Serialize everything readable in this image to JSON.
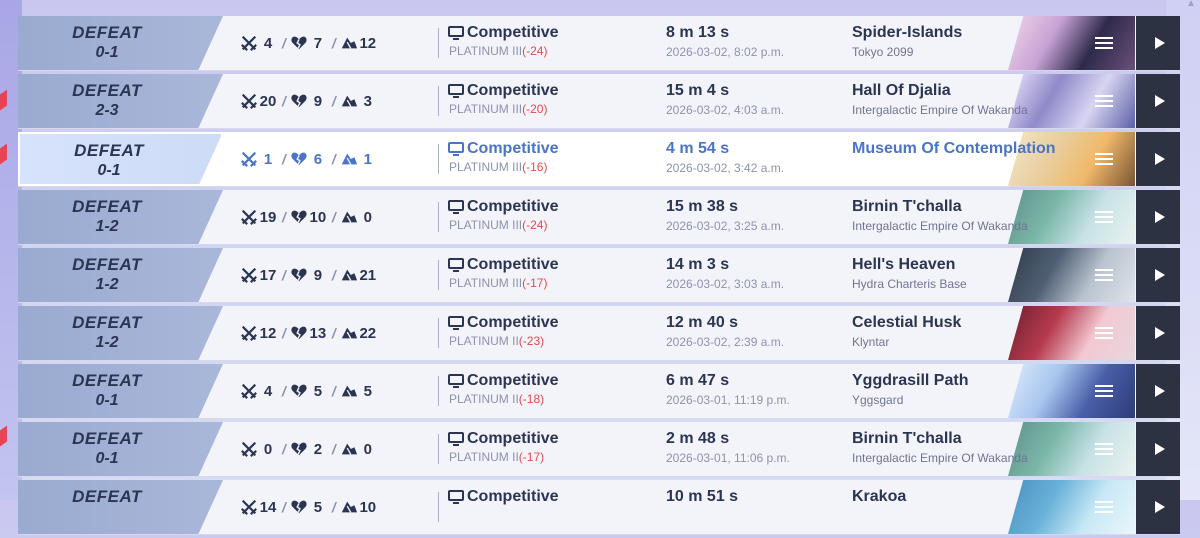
{
  "matches": [
    {
      "result": "DEFEAT",
      "score": "0-1",
      "kills": "4",
      "deaths": "7",
      "assists": "12",
      "mode": "Competitive",
      "rank": "PLATINUM III",
      "delta": "(-24)",
      "duration": "8 m 13 s",
      "date": "2026-03-02, 8:02 p.m.",
      "map": "Spider-Islands",
      "region": "Tokyo 2099",
      "thumb": [
        "#2e2a4a",
        "#c7a2d6",
        "#6b4f7a",
        "#f1d7e6"
      ]
    },
    {
      "result": "DEFEAT",
      "score": "2-3",
      "kills": "20",
      "deaths": "9",
      "assists": "3",
      "mode": "Competitive",
      "rank": "PLATINUM III",
      "delta": "(-20)",
      "duration": "15 m 4 s",
      "date": "2026-03-02, 4:03 a.m.",
      "map": "Hall Of Djalia",
      "region": "Intergalactic Empire Of Wakanda",
      "thumb": [
        "#d8d5f2",
        "#8f8ac9",
        "#5b5fa6",
        "#efe6ff"
      ]
    },
    {
      "result": "DEFEAT",
      "score": "0-1",
      "kills": "1",
      "deaths": "6",
      "assists": "1",
      "mode": "Competitive",
      "rank": "PLATINUM III",
      "delta": "(-16)",
      "duration": "4 m 54 s",
      "date": "2026-03-02, 3:42 a.m.",
      "map": "Museum Of Contemplation",
      "region": "",
      "thumb": [
        "#f0b96a",
        "#e8cfa0",
        "#7a5434",
        "#f6e6c9"
      ]
    },
    {
      "result": "DEFEAT",
      "score": "1-2",
      "kills": "19",
      "deaths": "10",
      "assists": "0",
      "mode": "Competitive",
      "rank": "PLATINUM III",
      "delta": "(-24)",
      "duration": "15 m 38 s",
      "date": "2026-03-02, 3:25 a.m.",
      "map": "Birnin T'challa",
      "region": "Intergalactic Empire Of Wakanda",
      "thumb": [
        "#c9e2e6",
        "#7bb7a9",
        "#e9f3f0",
        "#5e8f8a"
      ]
    },
    {
      "result": "DEFEAT",
      "score": "1-2",
      "kills": "17",
      "deaths": "9",
      "assists": "21",
      "mode": "Competitive",
      "rank": "PLATINUM III",
      "delta": "(-17)",
      "duration": "14 m 3 s",
      "date": "2026-03-02, 3:03 a.m.",
      "map": "Hell's Heaven",
      "region": "Hydra Charteris Base",
      "thumb": [
        "#b9c3cf",
        "#4f5f73",
        "#dfe4ea",
        "#2f3a49"
      ]
    },
    {
      "result": "DEFEAT",
      "score": "1-2",
      "kills": "12",
      "deaths": "13",
      "assists": "22",
      "mode": "Competitive",
      "rank": "PLATINUM II",
      "delta": "(-23)",
      "duration": "12 m 40 s",
      "date": "2026-03-02, 2:39 a.m.",
      "map": "Celestial Husk",
      "region": "Klyntar",
      "thumb": [
        "#f2c9d2",
        "#b63a4e",
        "#e8d6de",
        "#6d1f2f"
      ]
    },
    {
      "result": "DEFEAT",
      "score": "0-1",
      "kills": "4",
      "deaths": "5",
      "assists": "5",
      "mode": "Competitive",
      "rank": "PLATINUM II",
      "delta": "(-18)",
      "duration": "6 m 47 s",
      "date": "2026-03-01, 11:19 p.m.",
      "map": "Yggdrasill Path",
      "region": "Yggsgard",
      "thumb": [
        "#4a5ea8",
        "#a7c6ee",
        "#2c3c76",
        "#e0ecff"
      ]
    },
    {
      "result": "DEFEAT",
      "score": "0-1",
      "kills": "0",
      "deaths": "2",
      "assists": "0",
      "mode": "Competitive",
      "rank": "PLATINUM II",
      "delta": "(-17)",
      "duration": "2 m 48 s",
      "date": "2026-03-01, 11:06 p.m.",
      "map": "Birnin T'challa",
      "region": "Intergalactic Empire Of Wakanda",
      "thumb": [
        "#c9e2e6",
        "#7bb7a9",
        "#e9f3f0",
        "#5e8f8a"
      ]
    },
    {
      "result": "DEFEAT",
      "score": "",
      "kills": "14",
      "deaths": "5",
      "assists": "10",
      "mode": "Competitive",
      "rank": "",
      "delta": "",
      "duration": "10 m 51 s",
      "date": "",
      "map": "Krakoa",
      "region": "",
      "thumb": [
        "#c8e8f5",
        "#6ab2d9",
        "#eaf6fb",
        "#4a8fbf"
      ]
    }
  ],
  "colors": {
    "accent": "#4a74c7",
    "defeat_bg": "#9aaad0",
    "loss_delta": "#e14b4b",
    "play_bg": "#2c3242"
  },
  "icons": {
    "kills": "crossed-swords-icon",
    "deaths": "broken-heart-icon",
    "assists": "hands-icon",
    "mode": "monitor-icon",
    "menu": "menu-icon",
    "play": "play-icon"
  }
}
